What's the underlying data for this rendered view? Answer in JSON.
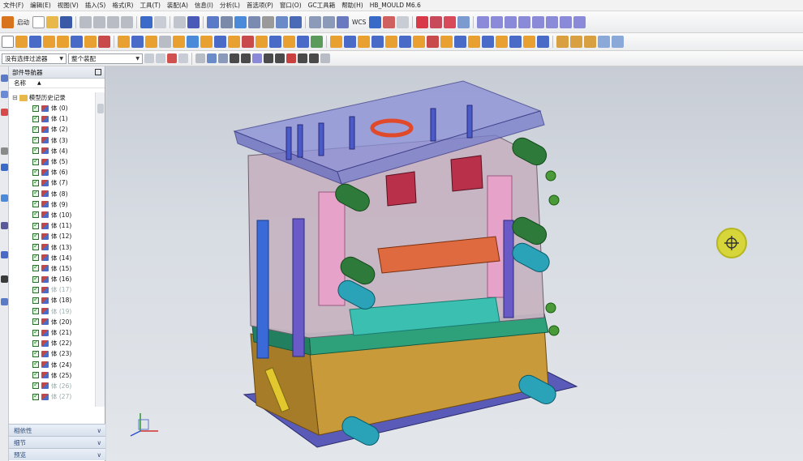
{
  "menubar": {
    "items": [
      "文件(F)",
      "编辑(E)",
      "视图(V)",
      "插入(S)",
      "格式(R)",
      "工具(T)",
      "装配(A)",
      "信息(I)",
      "分析(L)",
      "首选项(P)",
      "窗口(O)",
      "GC工具箱",
      "帮助(H)",
      "HB_MOULD M6.6"
    ]
  },
  "toolbar1": {
    "start_label": "启动",
    "wcs_label": "WCS"
  },
  "toolbar3": {
    "selection_filter": "没有选择过滤器",
    "assembly_scope": "整个装配"
  },
  "navigator": {
    "title": "部件导航器",
    "column_name": "名称",
    "root_label": "模型历史记录",
    "nodes": [
      {
        "label": "体 (0)"
      },
      {
        "label": "体 (1)"
      },
      {
        "label": "体 (2)"
      },
      {
        "label": "体 (3)"
      },
      {
        "label": "体 (4)"
      },
      {
        "label": "体 (5)"
      },
      {
        "label": "体 (6)"
      },
      {
        "label": "体 (7)"
      },
      {
        "label": "体 (8)"
      },
      {
        "label": "体 (9)"
      },
      {
        "label": "体 (10)"
      },
      {
        "label": "体 (11)"
      },
      {
        "label": "体 (12)"
      },
      {
        "label": "体 (13)"
      },
      {
        "label": "体 (14)"
      },
      {
        "label": "体 (15)"
      },
      {
        "label": "体 (16)"
      },
      {
        "label": "体 (17)"
      },
      {
        "label": "体 (18)"
      },
      {
        "label": "体 (19)"
      },
      {
        "label": "体 (20)"
      },
      {
        "label": "体 (21)"
      },
      {
        "label": "体 (22)"
      },
      {
        "label": "体 (23)"
      },
      {
        "label": "体 (24)"
      },
      {
        "label": "体 (25)"
      },
      {
        "label": "体 (26)"
      },
      {
        "label": "体 (27)"
      }
    ],
    "sections": {
      "dependencies": "相依性",
      "details": "细节",
      "preview": "预览"
    }
  },
  "colors": {
    "background_top": "#c7ccd5",
    "background_bottom": "#e3e6ea",
    "mould_top_plate": "#8a8fd8",
    "mould_base": "#c89a3a",
    "cursor_marker": "#d6d63a"
  }
}
